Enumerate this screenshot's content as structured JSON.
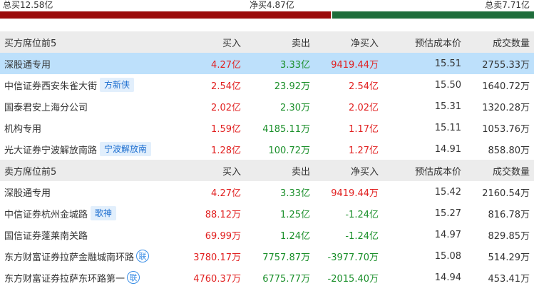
{
  "summary": {
    "total_buy": "总买12.58亿",
    "net_buy": "净买4.87亿",
    "total_sell": "总卖7.71亿"
  },
  "buy_ratio": 0.62,
  "headers": {
    "buy_section_title": "买方席位前5",
    "sell_section_title": "卖方席位前5",
    "buy": "买入",
    "sell": "卖出",
    "net": "净买入",
    "cost": "预估成本价",
    "volume": "成交数量"
  },
  "buy_rows": [
    {
      "name": "深股通专用",
      "tag": "",
      "icon": "",
      "buy": "4.27亿",
      "sell": "3.33亿",
      "net": "9419.44万",
      "cost": "15.51",
      "volume": "2755.33万"
    },
    {
      "name": "中信证券西安朱雀大街",
      "tag": "方新侠",
      "icon": "",
      "buy": "2.54亿",
      "sell": "23.92万",
      "net": "2.54亿",
      "cost": "15.50",
      "volume": "1640.72万"
    },
    {
      "name": "国泰君安上海分公司",
      "tag": "",
      "icon": "",
      "buy": "2.02亿",
      "sell": "2.30万",
      "net": "2.02亿",
      "cost": "15.31",
      "volume": "1320.28万"
    },
    {
      "name": "机构专用",
      "tag": "",
      "icon": "",
      "buy": "1.59亿",
      "sell": "4185.11万",
      "net": "1.17亿",
      "cost": "15.11",
      "volume": "1053.76万"
    },
    {
      "name": "光大证券宁波解放南路",
      "tag": "宁波解放南",
      "icon": "",
      "buy": "1.28亿",
      "sell": "100.72万",
      "net": "1.27亿",
      "cost": "14.91",
      "volume": "858.80万"
    }
  ],
  "sell_rows": [
    {
      "name": "深股通专用",
      "tag": "",
      "icon": "",
      "buy": "4.27亿",
      "sell": "3.33亿",
      "net": "9419.44万",
      "cost": "15.42",
      "volume": "2160.54万"
    },
    {
      "name": "中信证券杭州金城路",
      "tag": "歌神",
      "icon": "",
      "buy": "88.12万",
      "sell": "1.25亿",
      "net": "-1.24亿",
      "cost": "15.27",
      "volume": "816.78万"
    },
    {
      "name": "国信证券蓬莱南关路",
      "tag": "",
      "icon": "",
      "buy": "69.99万",
      "sell": "1.24亿",
      "net": "-1.24亿",
      "cost": "14.97",
      "volume": "829.85万"
    },
    {
      "name": "东方财富证券拉萨金融城南环路",
      "tag": "",
      "icon": "联",
      "buy": "3780.17万",
      "sell": "7757.87万",
      "net": "-3977.70万",
      "cost": "15.08",
      "volume": "514.29万"
    },
    {
      "name": "东方财富证券拉萨东环路第一",
      "tag": "",
      "icon": "联",
      "buy": "4760.37万",
      "sell": "6775.77万",
      "net": "-2015.40万",
      "cost": "14.94",
      "volume": "453.41万"
    }
  ],
  "colors": {
    "up": "#e11f1f",
    "down": "#1a8f2a",
    "buy_bar": "#9b0b0b",
    "sell_bar": "#1f6d3b",
    "highlight": "#bde0fb",
    "header_bg": "#ececec",
    "tag_text": "#1e6fd0",
    "tag_bg": "#e2effc"
  }
}
